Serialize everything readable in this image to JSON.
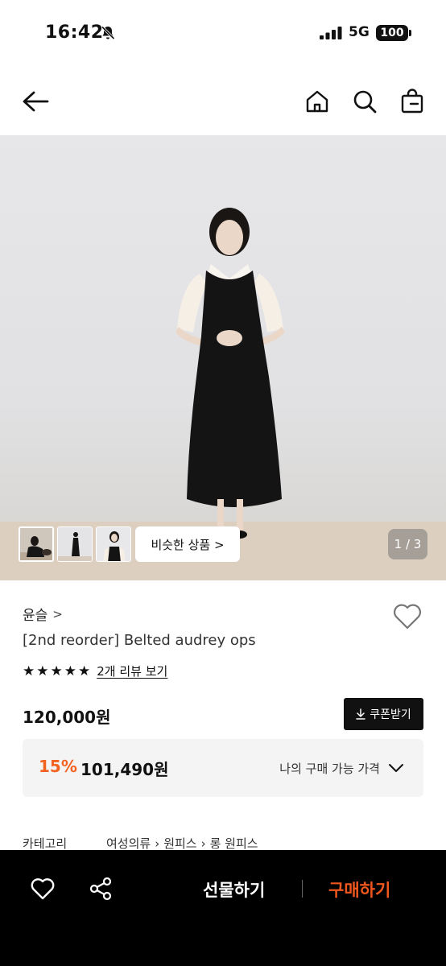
{
  "status_bar": {
    "time": "16:42",
    "network": "5G",
    "battery": "100"
  },
  "nav": {
    "back_icon": "arrow-left-icon",
    "home_icon": "home-icon",
    "search_icon": "search-icon",
    "bag_icon": "shopping-bag-icon"
  },
  "gallery": {
    "similar_label": "비슷한 상품 >",
    "counter": "1 / 3"
  },
  "product": {
    "brand": "윤슬",
    "brand_chevron": ">",
    "name": "[2nd reorder] Belted audrey ops",
    "rating_stars": 5,
    "review_link": "2개 리뷰 보기",
    "price": "120,000원",
    "coupon_label": "쿠폰받기"
  },
  "my_price": {
    "discount": "15%",
    "value": "101,490원",
    "label": "나의 구매 가능 가격"
  },
  "category": {
    "label": "카테고리",
    "path": [
      "여성의류",
      "원피스",
      "롱 원피스"
    ]
  },
  "bottom_bar": {
    "gift_label": "선물하기",
    "buy_label": "구매하기"
  },
  "colors": {
    "accent": "#f26322",
    "buy": "#f0571e",
    "dark": "#111111"
  }
}
